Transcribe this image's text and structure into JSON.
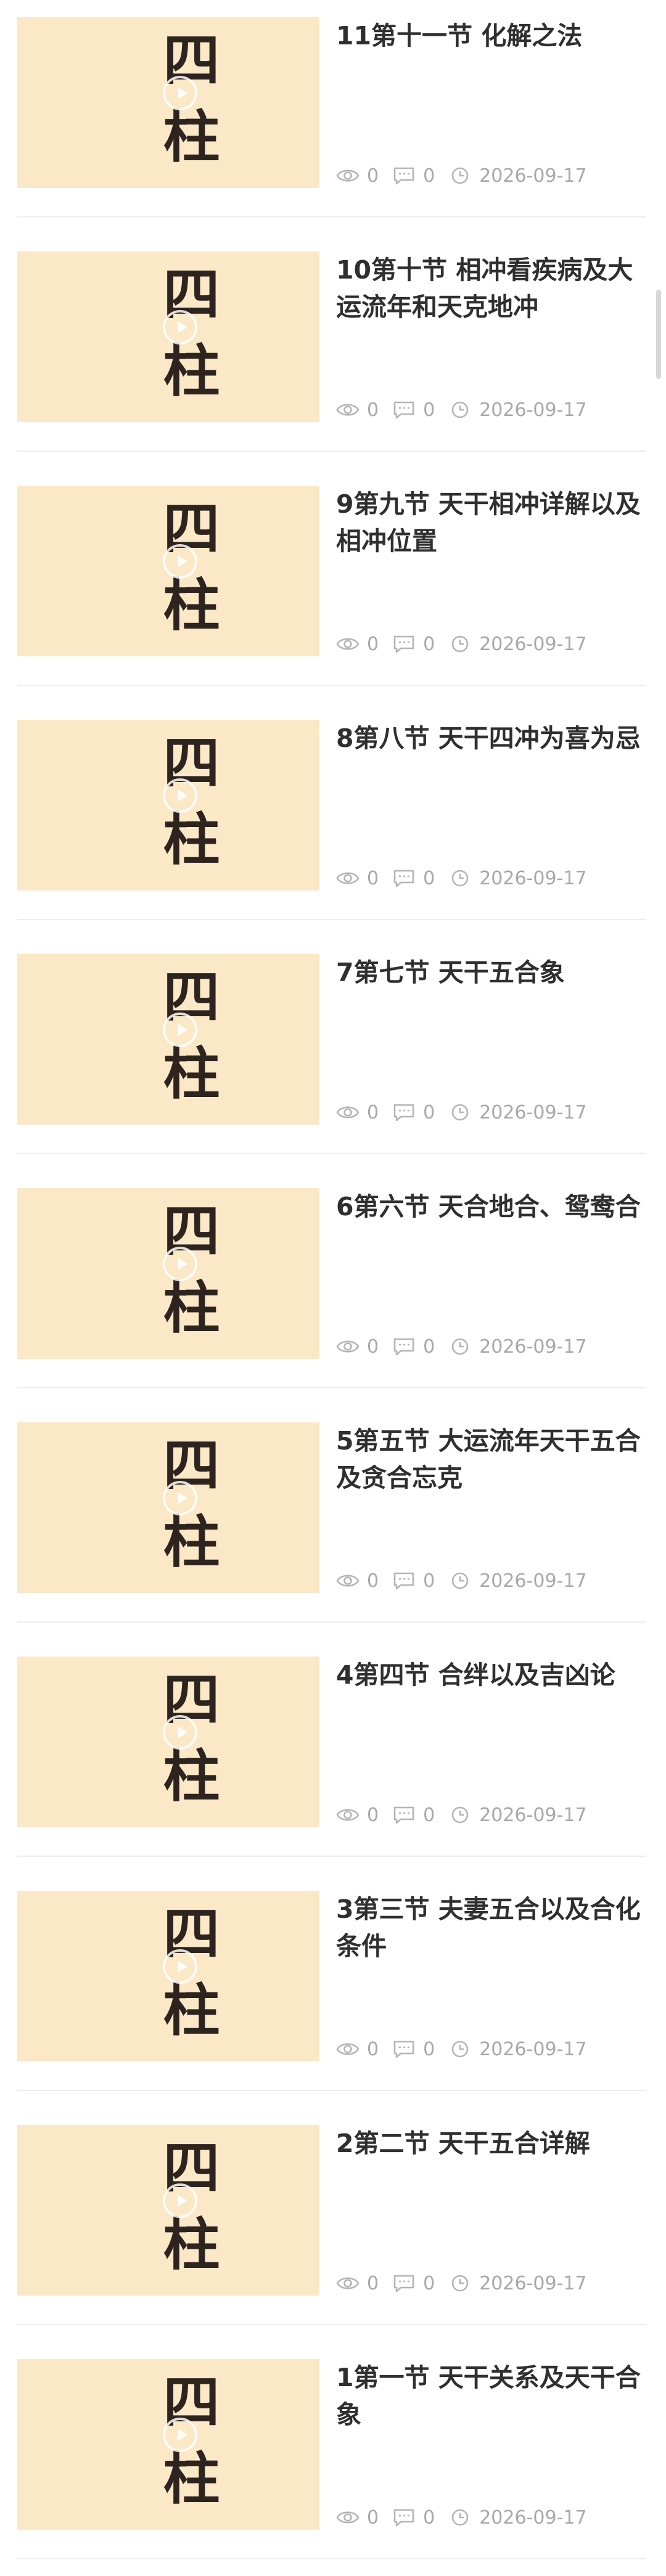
{
  "thumbnail_text": "四柱",
  "articles": [
    {
      "title": "11第十一节 化解之法",
      "views": "0",
      "comments": "0",
      "date": "2026-09-17"
    },
    {
      "title": "10第十节 相冲看疾病及大运流年和天克地冲",
      "views": "0",
      "comments": "0",
      "date": "2026-09-17"
    },
    {
      "title": "9第九节 天干相冲详解以及相冲位置",
      "views": "0",
      "comments": "0",
      "date": "2026-09-17"
    },
    {
      "title": "8第八节 天干四冲为喜为忌",
      "views": "0",
      "comments": "0",
      "date": "2026-09-17"
    },
    {
      "title": "7第七节 天干五合象",
      "views": "0",
      "comments": "0",
      "date": "2026-09-17"
    },
    {
      "title": "6第六节 天合地合、鸳鸯合",
      "views": "0",
      "comments": "0",
      "date": "2026-09-17"
    },
    {
      "title": "5第五节 大运流年天干五合及贪合忘克",
      "views": "0",
      "comments": "0",
      "date": "2026-09-17"
    },
    {
      "title": "4第四节 合绊以及吉凶论",
      "views": "0",
      "comments": "0",
      "date": "2026-09-17"
    },
    {
      "title": "3第三节 夫妻五合以及合化条件",
      "views": "0",
      "comments": "0",
      "date": "2026-09-17"
    },
    {
      "title": "2第二节 天干五合详解",
      "views": "0",
      "comments": "0",
      "date": "2026-09-17"
    },
    {
      "title": "1第一节 天干关系及天干合象",
      "views": "0",
      "comments": "0",
      "date": "2026-09-17"
    }
  ],
  "icons": {
    "views": "eye-icon",
    "comments": "comment-icon",
    "date": "clock-icon",
    "thumb_overlay": "play-icon"
  },
  "colors": {
    "thumb_background": "#fbe8c6",
    "thumb_text": "#2d2420",
    "title_text": "#2f2f2f",
    "meta_text": "#a8a8a8",
    "divider": "#ededed"
  }
}
